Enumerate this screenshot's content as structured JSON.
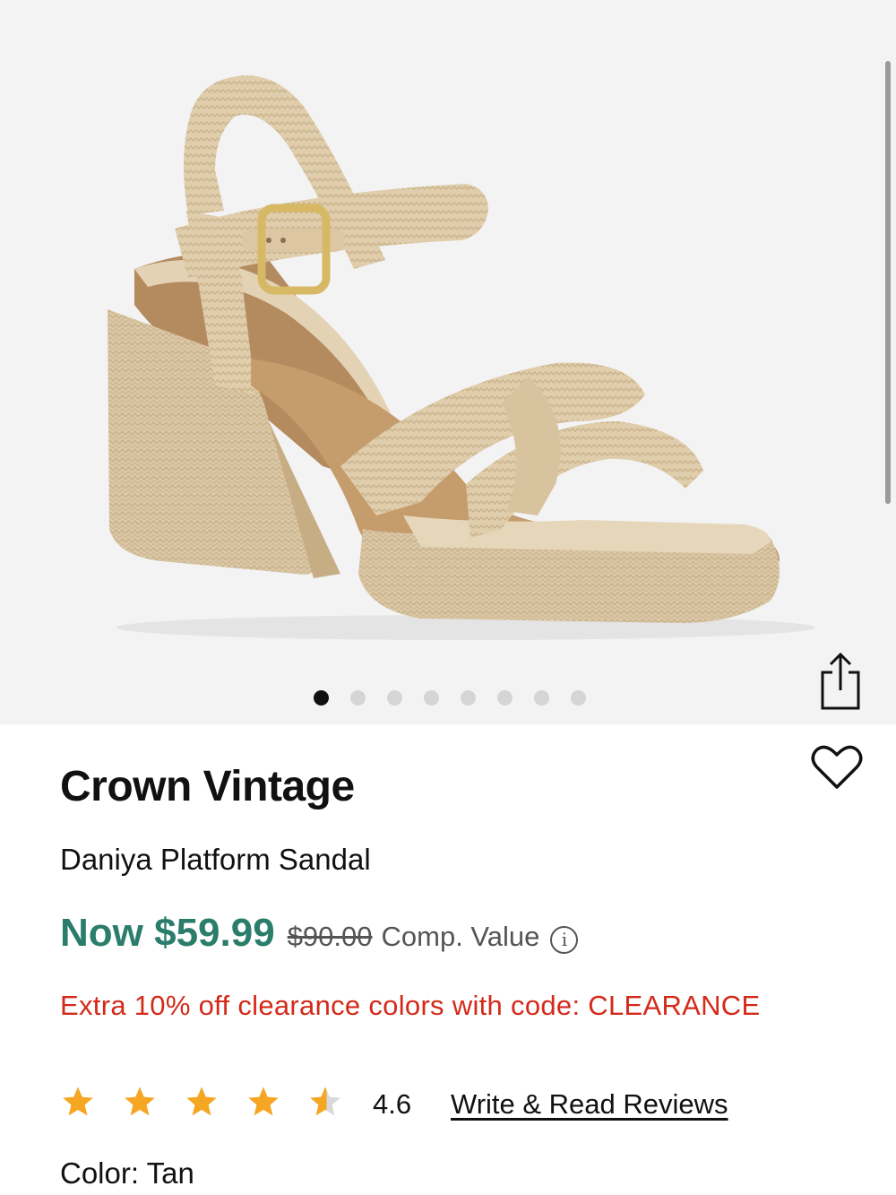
{
  "product": {
    "image_alt": "Tan woven raffia block-heel platform sandal with ankle strap and gold buckle",
    "gallery_count": 8,
    "gallery_active": 1,
    "brand": "Crown Vintage",
    "name": "Daniya Platform Sandal",
    "price_now": "Now $59.99",
    "price_was": "$90.00",
    "price_comp_label": "Comp. Value",
    "info_glyph": "i",
    "promo": "Extra 10% off clearance colors with code: CLEARANCE",
    "rating_value": "4.6",
    "rating_stars": 4.6,
    "reviews_link": "Write & Read Reviews",
    "color_label": "Color: Tan"
  },
  "colors": {
    "price_green": "#2b7d6b",
    "promo_red": "#d42a1a",
    "star_gold": "#f5a623",
    "hero_bg": "#f3f3f4"
  },
  "icons": {
    "share": "share-icon",
    "favorite": "heart-icon",
    "info": "info-icon",
    "star": "star-icon"
  }
}
